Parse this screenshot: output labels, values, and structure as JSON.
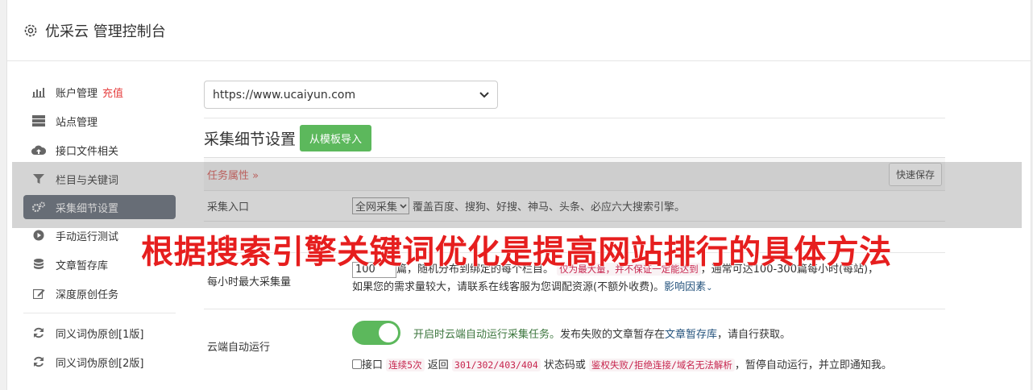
{
  "header": {
    "title": "优采云 管理控制台",
    "icon": "gear-icon"
  },
  "sidebar": {
    "items": [
      {
        "label": "账户管理",
        "badge": "充值",
        "icon": "bar-chart-icon"
      },
      {
        "label": "站点管理",
        "icon": "server-icon"
      },
      {
        "label": "接口文件相关",
        "icon": "cloud-upload-icon"
      },
      {
        "label": "栏目与关键词",
        "icon": "filter-icon"
      },
      {
        "label": "采集细节设置",
        "icon": "gears-icon",
        "active": true
      },
      {
        "label": "手动运行测试",
        "icon": "play-circle-icon"
      },
      {
        "label": "文章暂存库",
        "icon": "database-icon"
      },
      {
        "label": "深度原创任务",
        "icon": "edit-icon"
      },
      {
        "label": "同义词伪原创[1版]",
        "icon": "refresh-icon"
      },
      {
        "label": "同义词伪原创[2版]",
        "icon": "refresh-icon"
      }
    ]
  },
  "main": {
    "site_select": "https://www.ucaiyun.com",
    "section_title": "采集细节设置",
    "import_button": "从模板导入",
    "task_attr": "任务属性 »",
    "quick_save": "快速保存",
    "rows": {
      "entry": {
        "label": "采集入口",
        "select": "全网采集",
        "desc": "覆盖百度、搜狗、好搜、神马、头条、必应六大搜索引擎。"
      },
      "max_per_hour": {
        "label": "每小时最大采集量",
        "value": "100",
        "text1": "篇，随机分布到绑定的每个栏目。",
        "code1": "仅为最大量，并不保证一定能达到",
        "text2": "，通常可达100-300篇每小时(每站)，",
        "line2": "如果您的需求量较大，请联系在线客服为您调配资源(不额外收费)。",
        "link": "影响因素"
      },
      "cloud": {
        "label": "云端自动运行",
        "toggle_text": "开启时云端自动运行采集任务。",
        "text_a": "发布失败的文章暂存在",
        "link": "文章暂存库",
        "text_b": "，请自行获取。",
        "chk_label": "接口",
        "code_a": "连续5次",
        "text_c": "返回",
        "code_b": "301/302/403/404",
        "text_d": "状态码或",
        "code_c": "鉴权失败/拒绝连接/域名无法解析",
        "text_e": "，暂停自动运行，并立即通知我。"
      }
    }
  },
  "watermark": "根据搜索引擎关键词优化是提高网站排行的具体方法",
  "colors": {
    "accent_green": "#5cb85c",
    "active_sidebar": "#5f6775",
    "badge_red": "#e64040",
    "watermark_red": "#e61e1e"
  }
}
